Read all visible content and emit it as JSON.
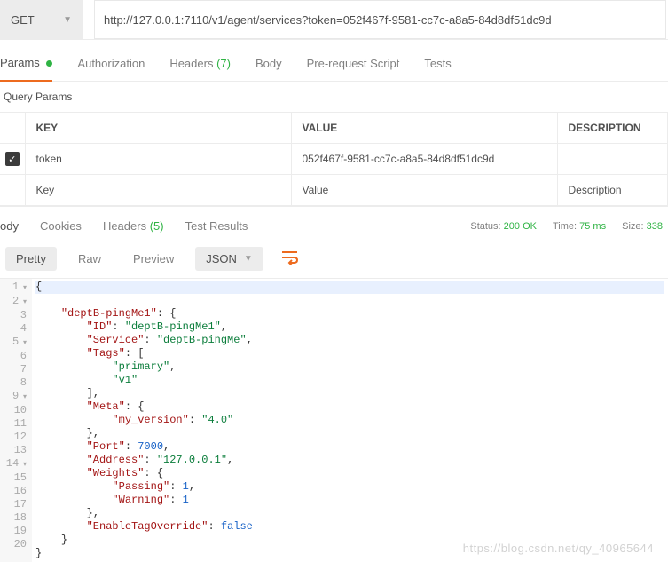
{
  "request": {
    "method": "GET",
    "url": "http://127.0.0.1:7110/v1/agent/services?token=052f467f-9581-cc7c-a8a5-84d8df51dc9d"
  },
  "tabs": {
    "params": "Params",
    "authorization": "Authorization",
    "headers": "Headers",
    "headers_count": "(7)",
    "body": "Body",
    "prerequest": "Pre-request Script",
    "tests": "Tests"
  },
  "query_params": {
    "title": "Query Params",
    "headers": {
      "key": "KEY",
      "value": "VALUE",
      "description": "DESCRIPTION"
    },
    "rows": [
      {
        "key": "token",
        "value": "052f467f-9581-cc7c-a8a5-84d8df51dc9d",
        "description": ""
      }
    ],
    "placeholder": {
      "key": "Key",
      "value": "Value",
      "description": "Description"
    }
  },
  "response_tabs": {
    "body": "ody",
    "cookies": "Cookies",
    "headers": "Headers",
    "headers_count": "(5)",
    "test_results": "Test Results"
  },
  "status": {
    "status_label": "Status:",
    "status_value": "200 OK",
    "time_label": "Time:",
    "time_value": "75 ms",
    "size_label": "Size:",
    "size_value": "338"
  },
  "format": {
    "pretty": "Pretty",
    "raw": "Raw",
    "preview": "Preview",
    "lang": "JSON"
  },
  "json_body": {
    "deptB-pingMe1": {
      "ID": "deptB-pingMe1",
      "Service": "deptB-pingMe",
      "Tags": [
        "primary",
        "v1"
      ],
      "Meta": {
        "my_version": "4.0"
      },
      "Port": 7000,
      "Address": "127.0.0.1",
      "Weights": {
        "Passing": 1,
        "Warning": 1
      },
      "EnableTagOverride": false
    }
  },
  "chart_data": {
    "type": "table",
    "title": "Query Params",
    "columns": [
      "KEY",
      "VALUE",
      "DESCRIPTION"
    ],
    "rows": [
      [
        "token",
        "052f467f-9581-cc7c-a8a5-84d8df51dc9d",
        ""
      ]
    ]
  },
  "watermark": "https://blog.csdn.net/qy_40965644"
}
